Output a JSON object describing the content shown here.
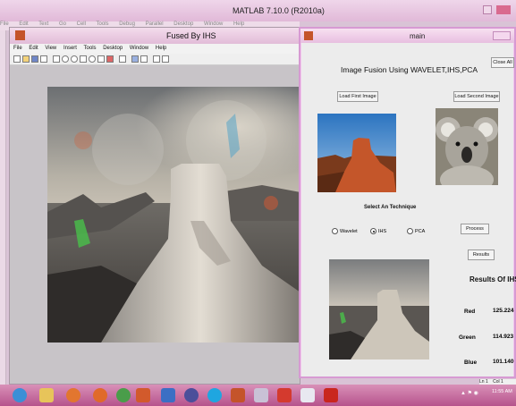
{
  "matlab": {
    "title": "MATLAB 7.10.0 (R2010a)",
    "menu": [
      "File",
      "Edit",
      "Text",
      "Go",
      "Cell",
      "Tools",
      "Debug",
      "Parallel",
      "Desktop",
      "Window",
      "Help"
    ]
  },
  "fused_window": {
    "title": "Fused By IHS",
    "menu": [
      "File",
      "Edit",
      "View",
      "Insert",
      "Tools",
      "Desktop",
      "Window",
      "Help"
    ]
  },
  "main_window": {
    "title": "main",
    "close_all_label": "Close All",
    "heading": "Image Fusion Using WAVELET,IHS,PCA",
    "load_first_label": "Load First Image",
    "load_second_label": "Load Second Image",
    "technique_heading": "Select An Technique",
    "techniques": [
      {
        "label": "Wavelet",
        "selected": false
      },
      {
        "label": "IHS",
        "selected": true
      },
      {
        "label": "PCA",
        "selected": false
      }
    ],
    "process_label": "Process",
    "results_label": "Results",
    "results_heading": "Results Of IHS",
    "results": [
      {
        "channel": "Red",
        "value": "125.224"
      },
      {
        "channel": "Green",
        "value": "114.923"
      },
      {
        "channel": "Blue",
        "value": "101.140"
      }
    ]
  },
  "status": {
    "ln": "Ln 1",
    "col": "Col 1"
  },
  "taskbar": {
    "time": "11:55 AM"
  },
  "colors": {
    "window_accent": "#f2c5ee",
    "taskbar": "#b6538c"
  }
}
